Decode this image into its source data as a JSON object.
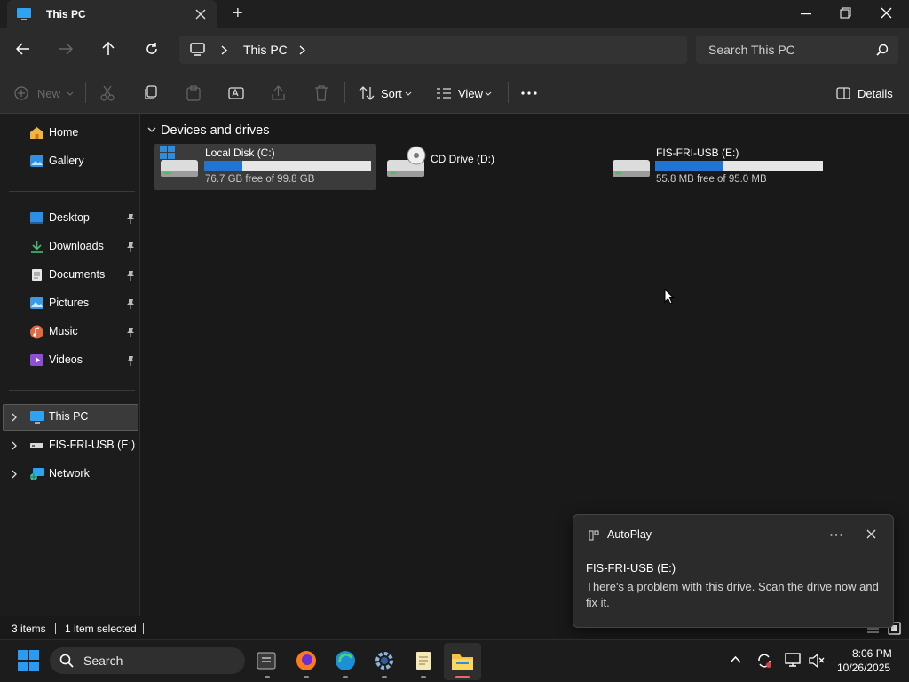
{
  "window": {
    "tab_title": "This PC",
    "new_tab": "+",
    "controls": {
      "minimize": "minimize-icon",
      "maximize": "restore-icon",
      "close": "close-icon"
    }
  },
  "address": {
    "crumb_root": "monitor-icon",
    "crumb": "This PC",
    "search_placeholder": "Search This PC"
  },
  "commands": {
    "new": "New",
    "sort": "Sort",
    "view": "View",
    "details": "Details"
  },
  "nav": {
    "home": "Home",
    "gallery": "Gallery",
    "quick": [
      {
        "label": "Desktop"
      },
      {
        "label": "Downloads"
      },
      {
        "label": "Documents"
      },
      {
        "label": "Pictures"
      },
      {
        "label": "Music"
      },
      {
        "label": "Videos"
      }
    ],
    "tree": [
      {
        "label": "This PC"
      },
      {
        "label": "FIS-FRI-USB (E:)"
      },
      {
        "label": "Network"
      }
    ]
  },
  "main": {
    "group_title": "Devices and drives",
    "drives": [
      {
        "name": "Local Disk (C:)",
        "free": "76.7 GB free of 99.8 GB",
        "used_fraction": 0.23
      },
      {
        "name": "CD Drive (D:)"
      },
      {
        "name": "FIS-FRI-USB (E:)",
        "free": "55.8 MB free of 95.0 MB",
        "used_fraction": 0.41
      }
    ]
  },
  "status": {
    "items": "3 items",
    "selected": "1 item selected"
  },
  "toast": {
    "app": "AutoPlay",
    "title": "FIS-FRI-USB (E:)",
    "message": "There's a problem with this drive.  Scan the drive now and fix it."
  },
  "taskbar": {
    "search": "Search",
    "time": "8:06 PM",
    "date": "10/26/2025"
  },
  "colors": {
    "accent": "#1f74d4",
    "background": "#191919"
  }
}
